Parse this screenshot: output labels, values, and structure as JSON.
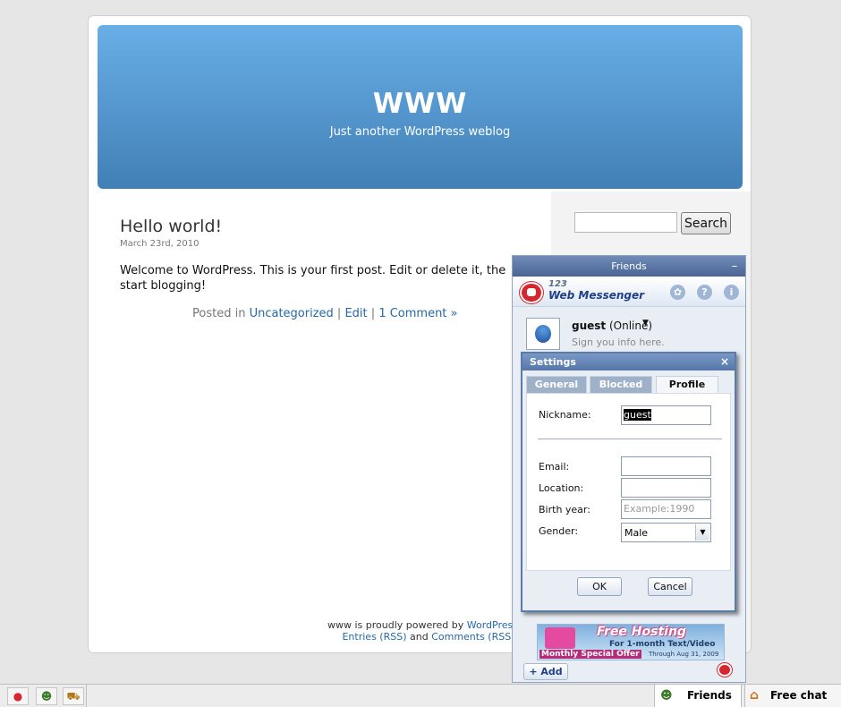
{
  "blog": {
    "title": "WWW",
    "description": "Just another WordPress weblog",
    "search_button": "Search",
    "post": {
      "title": "Hello world!",
      "date": "March 23rd, 2010",
      "body": "Welcome to WordPress. This is your first post. Edit or delete it, the start blogging!",
      "meta_prefix": "Posted in",
      "category": "Uncategorized",
      "edit": "Edit",
      "comments": "1 Comment »",
      "separator": "|"
    },
    "footer": {
      "line1_prefix": "www is proudly powered by",
      "line1_link": "WordPress",
      "entries_rss": "Entries (RSS)",
      "and": "and",
      "comments_rss": "Comments (RSS)."
    }
  },
  "messenger": {
    "title": "Friends",
    "minimize": "–",
    "brand_number": "123",
    "brand_name": "Web Messenger",
    "icons": [
      "gear-icon",
      "help-icon",
      "info-icon"
    ],
    "user": {
      "name": "guest",
      "status": "(Online)",
      "sign_info": "Sign you info here."
    },
    "settings": {
      "title": "Settings",
      "close": "×",
      "tabs": [
        {
          "label": "General",
          "active": false
        },
        {
          "label": "Blocked",
          "active": false
        },
        {
          "label": "Profile",
          "active": true
        }
      ],
      "nickname_label": "Nickname:",
      "nickname_value": "guest",
      "email_label": "Email:",
      "location_label": "Location:",
      "birth_year_label": "Birth year:",
      "birth_year_placeholder": "Example:1990",
      "gender_label": "Gender:",
      "gender_value": "Male",
      "ok": "OK",
      "cancel": "Cancel"
    },
    "banner": {
      "title": "Free Hosting",
      "subtitle": "For 1-month Text/Video",
      "offer": "Monthly Special Offer",
      "date": "Through Aug 31, 2009"
    },
    "add_button": "+ Add"
  },
  "taskbar": {
    "friends": "Friends",
    "free_chat": "Free chat"
  },
  "colors": {
    "header_top": "#69aee7",
    "header_bottom": "#4180b6",
    "link": "#2568a8",
    "messenger_titlebar": "#4a6594"
  }
}
